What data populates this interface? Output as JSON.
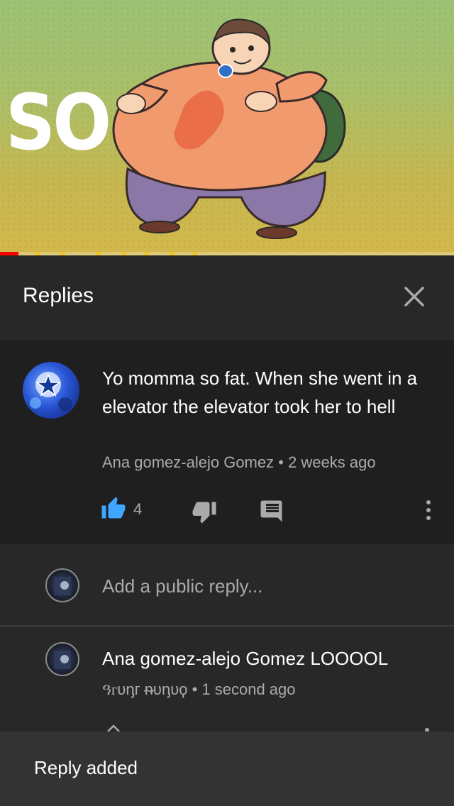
{
  "video": {
    "overlay_text": "SO",
    "progress_fraction": 0.04
  },
  "header": {
    "title": "Replies"
  },
  "comment": {
    "text": "Yo momma so fat. When she went in a elevator the elevator took her to hell",
    "author": "Ana gomez-alejo Gomez",
    "time": "2 weeks ago",
    "likes": "4",
    "meta_separator": " • "
  },
  "add_reply": {
    "placeholder": "Add a public reply..."
  },
  "reply": {
    "text": "Ana gomez-alejo Gomez LOOOOL",
    "author": "ዓꮁᴜᶇᴦ ᵰᴜᶇᴜϙ",
    "time": "1 second ago"
  },
  "snackbar": {
    "message": "Reply added"
  },
  "colors": {
    "like_active": "#3ea6ff",
    "icon_gray": "#aaaaaa",
    "progress_red": "#ff0000",
    "ad_marker": "#f6c11b"
  },
  "icons": [
    "close-icon",
    "thumbs-up-icon",
    "thumbs-down-icon",
    "reply-icon",
    "more-vert-icon"
  ]
}
